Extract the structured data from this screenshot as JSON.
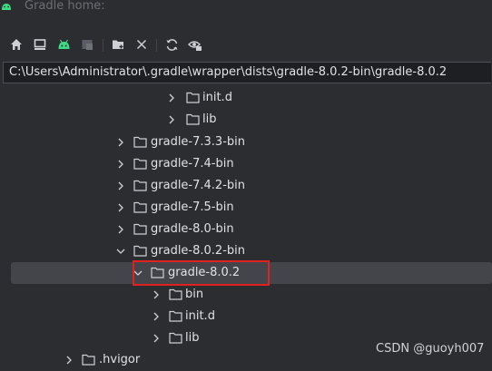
{
  "header": {
    "title": "Gradle home:"
  },
  "toolbar": {
    "icons": [
      "home-icon",
      "desktop-icon",
      "android-icon",
      "module-icon",
      "new-folder-icon",
      "delete-icon",
      "refresh-icon",
      "show-hidden-icon"
    ]
  },
  "path_field": {
    "value": "C:\\Users\\Administrator\\.gradle\\wrapper\\dists\\gradle-8.0.2-bin\\gradle-8.0.2"
  },
  "tree": {
    "rows": [
      {
        "label": "init.d",
        "expanded": false,
        "selected": false
      },
      {
        "label": "lib",
        "expanded": false,
        "selected": false
      },
      {
        "label": "gradle-7.3.3-bin",
        "expanded": false,
        "selected": false
      },
      {
        "label": "gradle-7.4-bin",
        "expanded": false,
        "selected": false
      },
      {
        "label": "gradle-7.4.2-bin",
        "expanded": false,
        "selected": false
      },
      {
        "label": "gradle-7.5-bin",
        "expanded": false,
        "selected": false
      },
      {
        "label": "gradle-8.0-bin",
        "expanded": false,
        "selected": false
      },
      {
        "label": "gradle-8.0.2-bin",
        "expanded": true,
        "selected": false
      },
      {
        "label": "gradle-8.0.2",
        "expanded": true,
        "selected": true
      },
      {
        "label": "bin",
        "expanded": false,
        "selected": false
      },
      {
        "label": "init.d",
        "expanded": false,
        "selected": false
      },
      {
        "label": "lib",
        "expanded": false,
        "selected": false
      },
      {
        "label": ".hvigor",
        "expanded": false,
        "selected": false
      }
    ]
  },
  "colors": {
    "background": "#2b2d30",
    "selection": "#43454a",
    "highlight_border": "#e0211f",
    "android_green": "#3ddc84"
  },
  "watermark": "CSDN @guoyh007"
}
